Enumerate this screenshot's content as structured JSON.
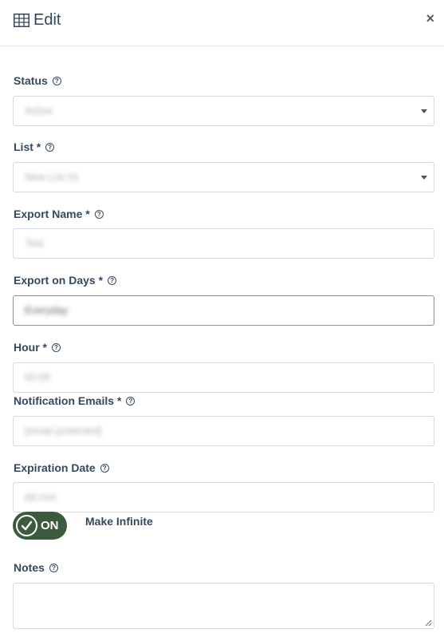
{
  "header": {
    "title": "Edit",
    "icon": "table-icon",
    "close": "×"
  },
  "help_glyph": "?",
  "fields": {
    "status": {
      "label": "Status",
      "value": "Active"
    },
    "list": {
      "label": "List *",
      "value": "New List 01"
    },
    "export_name": {
      "label": "Export Name *",
      "value": "Test"
    },
    "export_days": {
      "label": "Export on Days *",
      "value": "Everyday"
    },
    "hour": {
      "label": "Hour *",
      "value": "00:00"
    },
    "notification_emails": {
      "label": "Notification Emails *",
      "value": "[email protected]"
    },
    "expiration_date": {
      "label": "Expiration Date",
      "value": "dd.mm"
    },
    "notes": {
      "label": "Notes",
      "value": ""
    }
  },
  "toggle": {
    "state_label": "ON",
    "caption": "Make Infinite",
    "on": true
  },
  "colors": {
    "text": "#34495e",
    "toggle_bg": "#3c5a3e",
    "border": "#d5d9de"
  }
}
